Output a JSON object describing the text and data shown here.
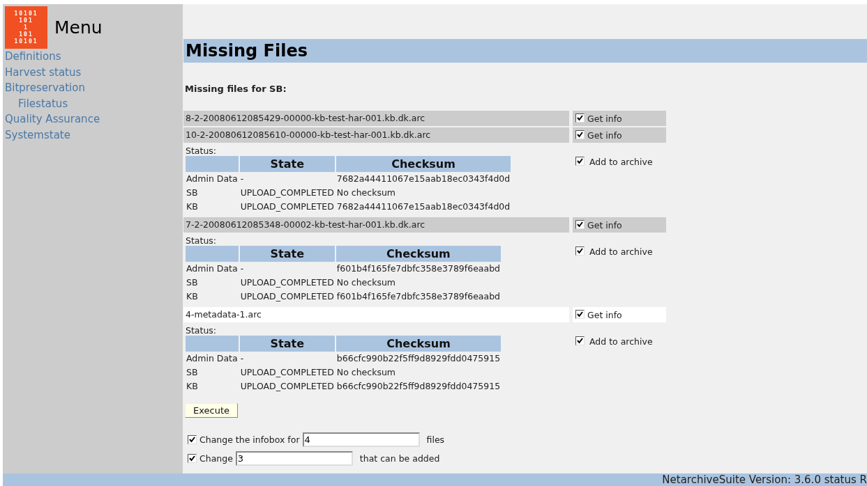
{
  "sidebar": {
    "logo": {
      "lines": [
        "10101",
        "101",
        "1",
        "101",
        "10101"
      ]
    },
    "title": "Menu",
    "items": [
      {
        "label": "Definitions"
      },
      {
        "label": "Harvest status"
      },
      {
        "label": "Bitpreservation",
        "children": [
          {
            "label": "Filestatus"
          }
        ]
      },
      {
        "label": "Quality Assurance"
      },
      {
        "label": "Systemstate"
      }
    ]
  },
  "page": {
    "title": "Missing Files",
    "subtitle": "Missing files for SB:",
    "files": [
      {
        "name": "8-2-20080612085429-00000-kb-test-har-001.kb.dk.arc",
        "shaded": true,
        "get_info": {
          "label": "Get info",
          "checked": true
        }
      },
      {
        "name": "10-2-20080612085610-00000-kb-test-har-001.kb.dk.arc",
        "shaded": true,
        "get_info": {
          "label": "Get info",
          "checked": true
        },
        "status": {
          "label": "Status:",
          "columns": [
            "State",
            "Checksum"
          ],
          "add": {
            "label": "Add to archive",
            "checked": true
          },
          "rows": [
            {
              "location": "Admin Data",
              "state": "-",
              "checksum": "7682a44411067e15aab18ec0343f4d0d"
            },
            {
              "location": "SB",
              "state": "UPLOAD_COMPLETED",
              "checksum": "No checksum"
            },
            {
              "location": "KB",
              "state": "UPLOAD_COMPLETED",
              "checksum": "7682a44411067e15aab18ec0343f4d0d"
            }
          ]
        }
      },
      {
        "name": "7-2-20080612085348-00002-kb-test-har-001.kb.dk.arc",
        "shaded": true,
        "get_info": {
          "label": "Get info",
          "checked": true
        },
        "status": {
          "label": "Status:",
          "columns": [
            "State",
            "Checksum"
          ],
          "add": {
            "label": "Add to archive",
            "checked": true
          },
          "rows": [
            {
              "location": "Admin Data",
              "state": "-",
              "checksum": "f601b4f165fe7dbfc358e3789f6eaabd"
            },
            {
              "location": "SB",
              "state": "UPLOAD_COMPLETED",
              "checksum": "No checksum"
            },
            {
              "location": "KB",
              "state": "UPLOAD_COMPLETED",
              "checksum": "f601b4f165fe7dbfc358e3789f6eaabd"
            }
          ]
        }
      },
      {
        "name": "4-metadata-1.arc",
        "shaded": false,
        "get_info": {
          "label": "Get info",
          "checked": true
        },
        "status": {
          "label": "Status:",
          "columns": [
            "State",
            "Checksum"
          ],
          "add": {
            "label": "Add to archive",
            "checked": true
          },
          "rows": [
            {
              "location": "Admin Data",
              "state": "-",
              "checksum": "b66cfc990b22f5ff9d8929fdd0475915"
            },
            {
              "location": "SB",
              "state": "UPLOAD_COMPLETED",
              "checksum": "No checksum"
            },
            {
              "location": "KB",
              "state": "UPLOAD_COMPLETED",
              "checksum": "b66cfc990b22f5ff9d8929fdd0475915"
            }
          ]
        }
      }
    ],
    "execute": "Execute",
    "options": [
      {
        "checked": true,
        "before": "Change the infobox for",
        "value": "4",
        "after": "files"
      },
      {
        "checked": true,
        "before": "Change",
        "value": "3",
        "after": "that can be added"
      }
    ]
  },
  "footer": {
    "text": "NetarchiveSuite Version: 3.6.0 status R"
  }
}
